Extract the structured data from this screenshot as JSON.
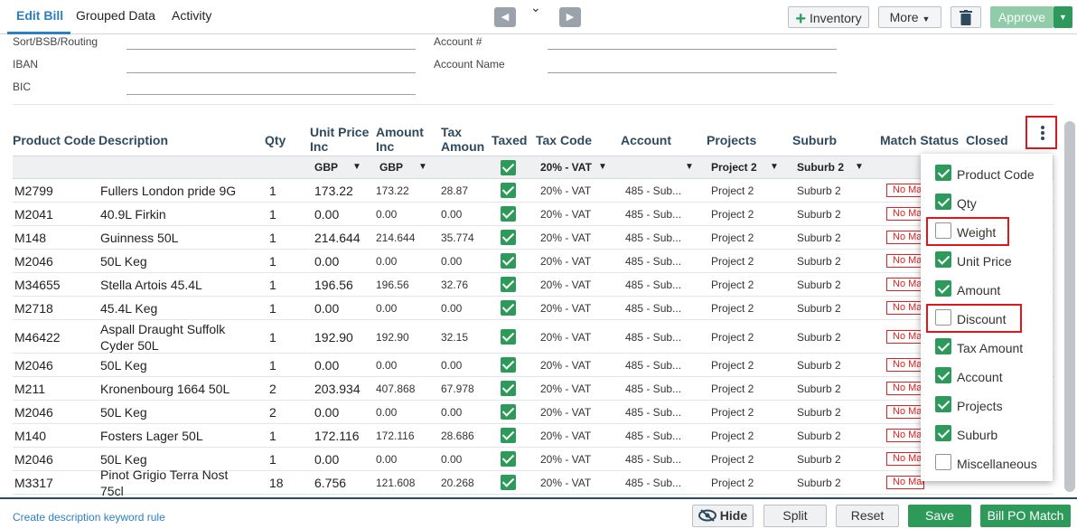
{
  "tabs": [
    "Edit Bill",
    "Grouped Data",
    "Activity"
  ],
  "toolbar": {
    "prev_icon": "chevron-left",
    "collapse_icon": "chevron-down",
    "next_icon": "chevron-right",
    "inventory_label": "Inventory",
    "more_label": "More",
    "delete_icon": "trash",
    "approve_label": "Approve"
  },
  "bank": {
    "sort_label": "Sort/BSB/Routing",
    "iban_label": "IBAN",
    "bic_label": "BIC",
    "account_no_label": "Account #",
    "account_name_label": "Account Name"
  },
  "columns": {
    "product_code": "Product Code",
    "description": "Description",
    "qty": "Qty",
    "unit_price": "Unit Price Inc",
    "amount": "Amount Inc",
    "tax_amount": "Tax Amoun",
    "taxed": "Taxed",
    "tax_code": "Tax Code",
    "account": "Account",
    "projects": "Projects",
    "suburb": "Suburb",
    "match_status": "Match Status",
    "closed": "Closed"
  },
  "filters": {
    "unit_price_currency": "GBP",
    "amount_currency": "GBP",
    "tax_code": "20% - VAT",
    "projects": "Project 2",
    "suburb": "Suburb 2"
  },
  "rows": [
    {
      "code": "M2799",
      "desc": "Fullers London pride 9G",
      "qty": "1",
      "unit": "173.22",
      "amount": "173.22",
      "tax": "28.87",
      "tax_code": "20% - VAT",
      "account": "485 - Sub...",
      "project": "Project 2",
      "suburb": "Suburb 2",
      "match": "No Match"
    },
    {
      "code": "M2041",
      "desc": "40.9L Firkin",
      "qty": "1",
      "unit": "0.00",
      "amount": "0.00",
      "tax": "0.00",
      "tax_code": "20% - VAT",
      "account": "485 - Sub...",
      "project": "Project 2",
      "suburb": "Suburb 2",
      "match": "No Match"
    },
    {
      "code": "M148",
      "desc": "Guinness  50L",
      "qty": "1",
      "unit": "214.644",
      "amount": "214.644",
      "tax": "35.774",
      "tax_code": "20% - VAT",
      "account": "485 - Sub...",
      "project": "Project 2",
      "suburb": "Suburb 2",
      "match": "No Match"
    },
    {
      "code": "M2046",
      "desc": "50L Keg",
      "qty": "1",
      "unit": "0.00",
      "amount": "0.00",
      "tax": "0.00",
      "tax_code": "20% - VAT",
      "account": "485 - Sub...",
      "project": "Project 2",
      "suburb": "Suburb 2",
      "match": "No Match"
    },
    {
      "code": "M34655",
      "desc": "Stella Artois  45.4L",
      "qty": "1",
      "unit": "196.56",
      "amount": "196.56",
      "tax": "32.76",
      "tax_code": "20% - VAT",
      "account": "485 - Sub...",
      "project": "Project 2",
      "suburb": "Suburb 2",
      "match": "No Match"
    },
    {
      "code": "M2718",
      "desc": "45.4L Keg",
      "qty": "1",
      "unit": "0.00",
      "amount": "0.00",
      "tax": "0.00",
      "tax_code": "20% - VAT",
      "account": "485 - Sub...",
      "project": "Project 2",
      "suburb": "Suburb 2",
      "match": "No Match"
    },
    {
      "code": "M46422",
      "desc": "Aspall Draught Suffolk Cyder 50L",
      "qty": "1",
      "unit": "192.90",
      "amount": "192.90",
      "tax": "32.15",
      "tax_code": "20% - VAT",
      "account": "485 - Sub...",
      "project": "Project 2",
      "suburb": "Suburb 2",
      "match": "No Match"
    },
    {
      "code": "M2046",
      "desc": "50L Keg",
      "qty": "1",
      "unit": "0.00",
      "amount": "0.00",
      "tax": "0.00",
      "tax_code": "20% - VAT",
      "account": "485 - Sub...",
      "project": "Project 2",
      "suburb": "Suburb 2",
      "match": "No Match"
    },
    {
      "code": "M211",
      "desc": "Kronenbourg 1664  50L",
      "qty": "2",
      "unit": "203.934",
      "amount": "407.868",
      "tax": "67.978",
      "tax_code": "20% - VAT",
      "account": "485 - Sub...",
      "project": "Project 2",
      "suburb": "Suburb 2",
      "match": "No Match"
    },
    {
      "code": "M2046",
      "desc": "50L Keg",
      "qty": "2",
      "unit": "0.00",
      "amount": "0.00",
      "tax": "0.00",
      "tax_code": "20% - VAT",
      "account": "485 - Sub...",
      "project": "Project 2",
      "suburb": "Suburb 2",
      "match": "No Match"
    },
    {
      "code": "M140",
      "desc": "Fosters Lager  50L",
      "qty": "1",
      "unit": "172.116",
      "amount": "172.116",
      "tax": "28.686",
      "tax_code": "20% - VAT",
      "account": "485 - Sub...",
      "project": "Project 2",
      "suburb": "Suburb 2",
      "match": "No Match"
    },
    {
      "code": "M2046",
      "desc": "50L Keg",
      "qty": "1",
      "unit": "0.00",
      "amount": "0.00",
      "tax": "0.00",
      "tax_code": "20% - VAT",
      "account": "485 - Sub...",
      "project": "Project 2",
      "suburb": "Suburb 2",
      "match": "No Match"
    },
    {
      "code": "M3317",
      "desc": "Pinot Grigio Terra Nost  75cl",
      "qty": "18",
      "unit": "6.756",
      "amount": "121.608",
      "tax": "20.268",
      "tax_code": "20% - VAT",
      "account": "485 - Sub...",
      "project": "Project 2",
      "suburb": "Suburb 2",
      "match": "No Match"
    }
  ],
  "column_menu": [
    {
      "label": "Product Code",
      "checked": true,
      "highlighted": false
    },
    {
      "label": "Qty",
      "checked": true,
      "highlighted": false
    },
    {
      "label": "Weight",
      "checked": false,
      "highlighted": true
    },
    {
      "label": "Unit Price",
      "checked": true,
      "highlighted": false
    },
    {
      "label": "Amount",
      "checked": true,
      "highlighted": false
    },
    {
      "label": "Discount",
      "checked": false,
      "highlighted": true
    },
    {
      "label": "Tax Amount",
      "checked": true,
      "highlighted": false
    },
    {
      "label": "Account",
      "checked": true,
      "highlighted": false
    },
    {
      "label": "Projects",
      "checked": true,
      "highlighted": false
    },
    {
      "label": "Suburb",
      "checked": true,
      "highlighted": false
    },
    {
      "label": "Miscellaneous",
      "checked": false,
      "highlighted": false
    }
  ],
  "footer": {
    "keyword_rule_link": "Create description keyword rule",
    "hide_label": "Hide",
    "split_label": "Split",
    "reset_label": "Reset",
    "save_label": "Save",
    "bill_po_label": "Bill PO Match"
  },
  "colors": {
    "accent_blue": "#2d7fc1",
    "green": "#2e9a5a",
    "highlight_red": "#e0161c",
    "header_text": "#2f4a5e"
  }
}
